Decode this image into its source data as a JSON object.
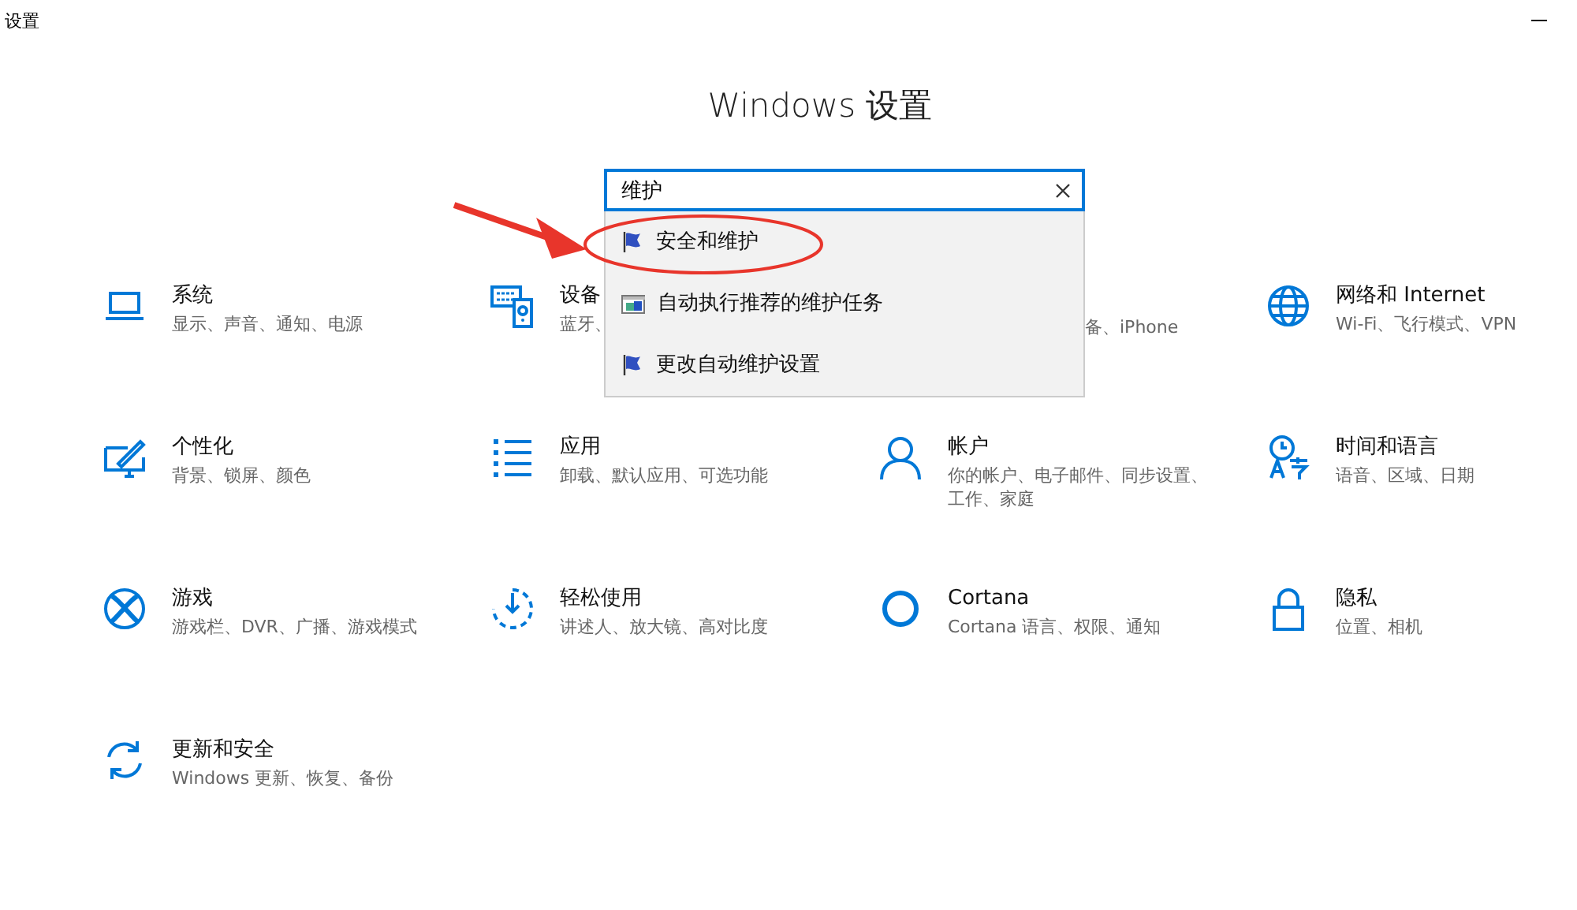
{
  "window": {
    "title": "设置"
  },
  "heading": "Windows 设置",
  "search": {
    "value": "维护"
  },
  "suggestions": [
    {
      "label": "安全和维护",
      "kind": "flag"
    },
    {
      "label": "自动执行推荐的维护任务",
      "kind": "task"
    },
    {
      "label": "更改自动维护设置",
      "kind": "flag"
    }
  ],
  "tiles": [
    {
      "title": "系统",
      "subtitle": "显示、声音、通知、电源",
      "kind": "laptop"
    },
    {
      "title": "设备",
      "subtitle": "蓝牙、",
      "kind": "devices"
    },
    {
      "subtitle": "备、iPhone",
      "kind": "covered"
    },
    {
      "title": "网络和 Internet",
      "subtitle": "Wi-Fi、飞行模式、VPN",
      "kind": "globe"
    },
    {
      "title": "个性化",
      "subtitle": "背景、锁屏、颜色",
      "kind": "paint"
    },
    {
      "title": "应用",
      "subtitle": "卸载、默认应用、可选功能",
      "kind": "list"
    },
    {
      "title": "帐户",
      "subtitle": "你的帐户、电子邮件、同步设置、工作、家庭",
      "kind": "person"
    },
    {
      "title": "时间和语言",
      "subtitle": "语音、区域、日期",
      "kind": "language"
    },
    {
      "title": "游戏",
      "subtitle": "游戏栏、DVR、广播、游戏模式",
      "kind": "xbox"
    },
    {
      "title": "轻松使用",
      "subtitle": "讲述人、放大镜、高对比度",
      "kind": "ease"
    },
    {
      "title": "Cortana",
      "subtitle": "Cortana 语言、权限、通知",
      "kind": "ring"
    },
    {
      "title": "隐私",
      "subtitle": "位置、相机",
      "kind": "lock"
    },
    {
      "title": "更新和安全",
      "subtitle": "Windows 更新、恢复、备份",
      "kind": "sync"
    }
  ]
}
